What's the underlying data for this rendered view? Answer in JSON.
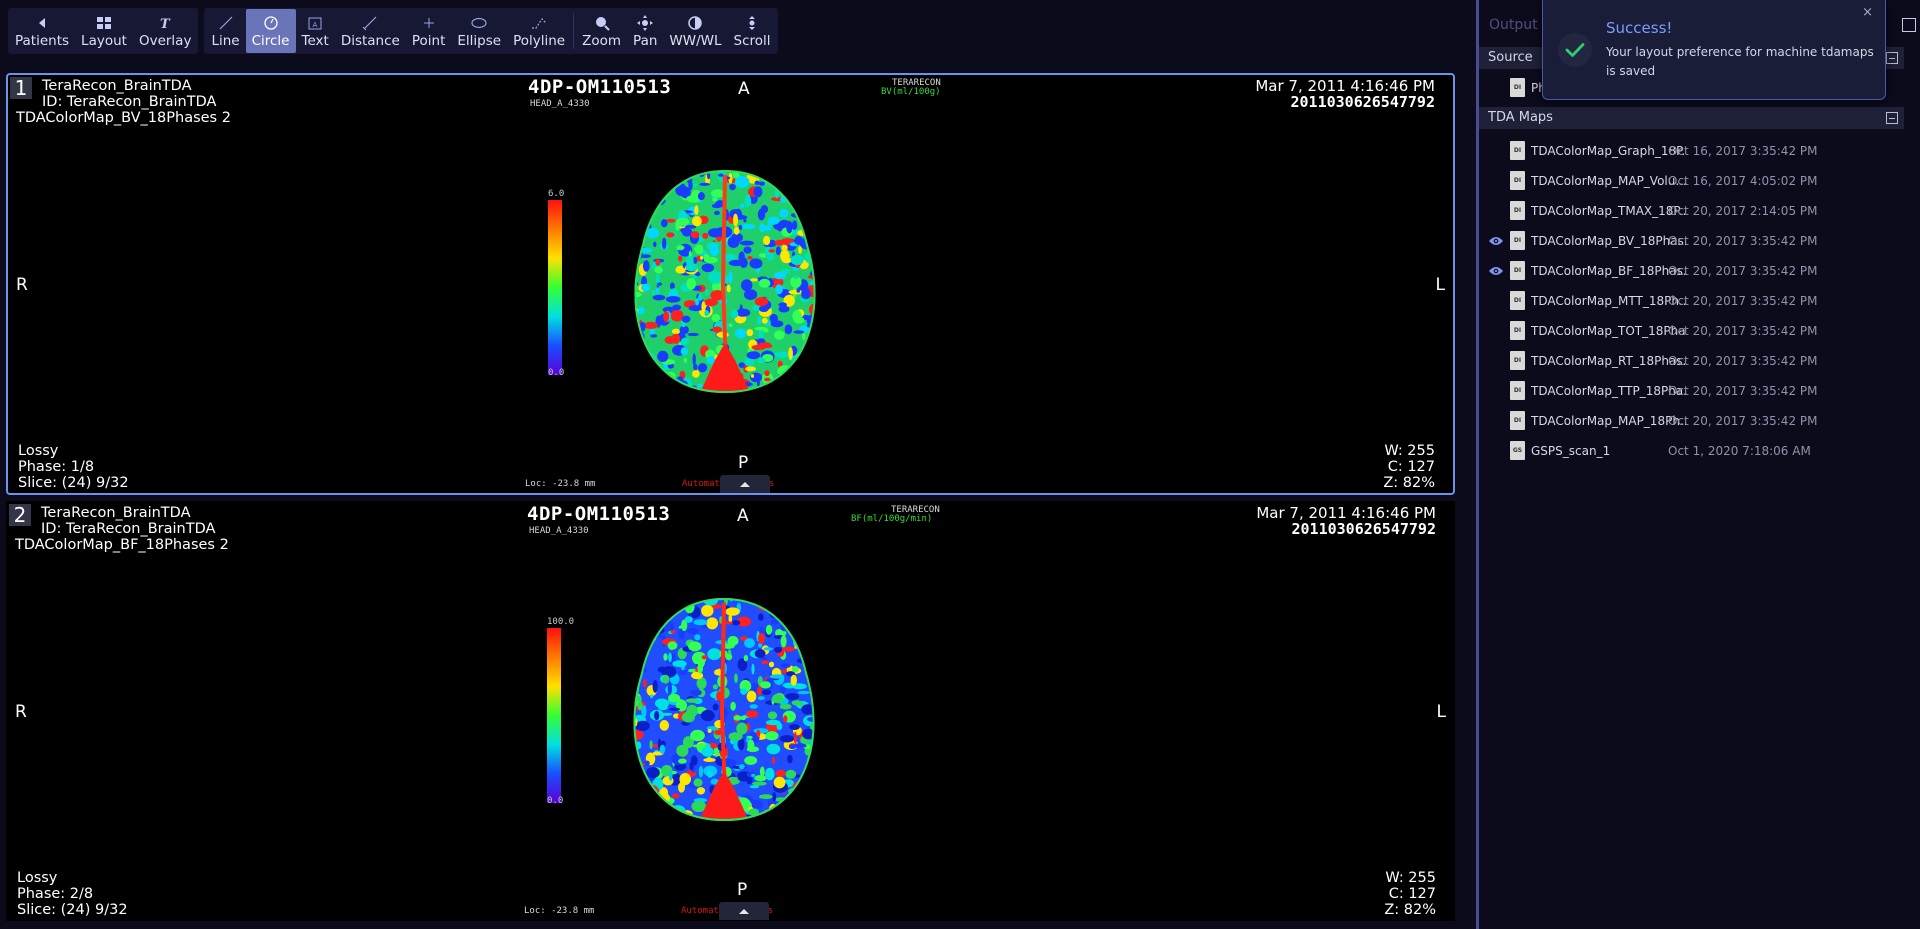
{
  "toolbar": {
    "group1": [
      {
        "label": "Patients",
        "icon": "arrow-left-icon"
      },
      {
        "label": "Layout",
        "icon": "layout-grid-icon"
      },
      {
        "label": "Overlay",
        "icon": "overlay-text-icon"
      }
    ],
    "group2": [
      {
        "label": "Line",
        "icon": "line-icon"
      },
      {
        "label": "Circle",
        "icon": "circle-icon",
        "active": true
      },
      {
        "label": "Text",
        "icon": "text-box-icon"
      },
      {
        "label": "Distance",
        "icon": "distance-icon"
      },
      {
        "label": "Point",
        "icon": "point-icon"
      },
      {
        "label": "Ellipse",
        "icon": "ellipse-icon"
      },
      {
        "label": "Polyline",
        "icon": "polyline-icon"
      },
      {
        "label": "Zoom",
        "icon": "zoom-icon"
      },
      {
        "label": "Pan",
        "icon": "pan-icon"
      },
      {
        "label": "WW/WL",
        "icon": "contrast-icon"
      },
      {
        "label": "Scroll",
        "icon": "scroll-icon"
      }
    ]
  },
  "viewports": [
    {
      "number": "1",
      "patient_name": "TeraRecon_BrainTDA",
      "patient_id": "ID: TeraRecon_BrainTDA",
      "series": "TDAColorMap_BV_18Phases 2",
      "study": "4DP-OM110513",
      "study_sub": "HEAD_A_4330",
      "brand": "TERARECON",
      "map_unit": "BV(ml/100g)",
      "date": "Mar 7, 2011 4:16:46 PM",
      "accession": "2011030626547792",
      "orient_top": "A",
      "orient_left": "R",
      "orient_right": "L",
      "orient_bottom": "P",
      "cbar_max": "6.0",
      "cbar_min": "0.0",
      "compression": "Lossy",
      "phase": "Phase: 1/8",
      "slice": "Slice: (24) 9/32",
      "loc": "Loc: -23.8 mm",
      "auto_results": "Automatic Results",
      "ww": "W: 255",
      "wc": "C: 127",
      "zoom": "Z: 82%"
    },
    {
      "number": "2",
      "patient_name": "TeraRecon_BrainTDA",
      "patient_id": "ID: TeraRecon_BrainTDA",
      "series": "TDAColorMap_BF_18Phases 2",
      "study": "4DP-OM110513",
      "study_sub": "HEAD_A_4330",
      "brand": "TERARECON",
      "map_unit": "BF(ml/100g/min)",
      "date": "Mar 7, 2011 4:16:46 PM",
      "accession": "2011030626547792",
      "orient_top": "A",
      "orient_left": "R",
      "orient_right": "L",
      "orient_bottom": "P",
      "cbar_max": "100.0",
      "cbar_min": "0.0",
      "compression": "Lossy",
      "phase": "Phase: 2/8",
      "slice": "Slice: (24) 9/32",
      "loc": "Loc: -23.8 mm",
      "auto_results": "Automatic Results",
      "ww": "W: 255",
      "wc": "C: 127",
      "zoom": "Z: 82%"
    }
  ],
  "panel": {
    "title": "Output R",
    "source_header": "Source",
    "source_item": "Ph",
    "tda_header": "TDA Maps",
    "series": [
      {
        "name": "TDAColorMap_Graph_18P...",
        "date": "Oct 16, 2017 3:35:42 PM",
        "visible": false,
        "type": "DI"
      },
      {
        "name": "TDAColorMap_MAP_Volu...",
        "date": "Oct 16, 2017 4:05:02 PM",
        "visible": false,
        "type": "DI"
      },
      {
        "name": "TDAColorMap_TMAX_18P...",
        "date": "Oct 20, 2017 2:14:05 PM",
        "visible": false,
        "type": "DI"
      },
      {
        "name": "TDAColorMap_BV_18Phas...",
        "date": "Oct 20, 2017 3:35:42 PM",
        "visible": true,
        "type": "DI"
      },
      {
        "name": "TDAColorMap_BF_18Phas...",
        "date": "Oct 20, 2017 3:35:42 PM",
        "visible": true,
        "type": "DI"
      },
      {
        "name": "TDAColorMap_MTT_18Ph...",
        "date": "Oct 20, 2017 3:35:42 PM",
        "visible": false,
        "type": "DI"
      },
      {
        "name": "TDAColorMap_TOT_18Pha...",
        "date": "Oct 20, 2017 3:35:42 PM",
        "visible": false,
        "type": "DI"
      },
      {
        "name": "TDAColorMap_RT_18Phas...",
        "date": "Oct 20, 2017 3:35:42 PM",
        "visible": false,
        "type": "DI"
      },
      {
        "name": "TDAColorMap_TTP_18Pha...",
        "date": "Oct 20, 2017 3:35:42 PM",
        "visible": false,
        "type": "DI"
      },
      {
        "name": "TDAColorMap_MAP_18Ph...",
        "date": "Oct 20, 2017 3:35:42 PM",
        "visible": false,
        "type": "DI"
      },
      {
        "name": "GSPS_scan_1",
        "date": "Oct 1, 2020 7:18:06 AM",
        "visible": false,
        "type": "GS"
      }
    ]
  },
  "toast": {
    "title": "Success!",
    "message": "Your layout preference for machine tdamaps is saved",
    "close": "×"
  },
  "colors": {
    "accent": "#6a74b8",
    "selected_border": "#6b94e8",
    "toast_title": "#7b9cff",
    "success_check": "#2ecc71"
  }
}
